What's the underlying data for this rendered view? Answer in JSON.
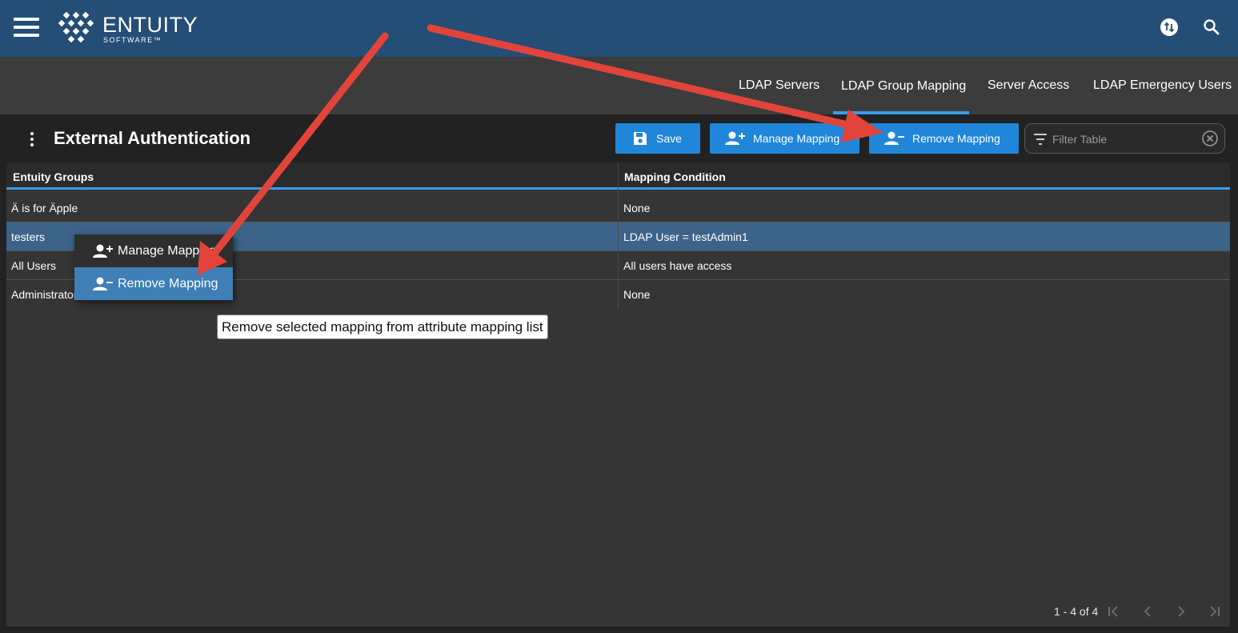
{
  "brand": {
    "name": "ENTUITY",
    "sub": "SOFTWARE™"
  },
  "header_icons": [
    "hamburger-menu-icon",
    "sync-icon",
    "search-icon"
  ],
  "tabs": [
    {
      "label": "LDAP Servers",
      "active": false
    },
    {
      "label": "LDAP Group Mapping",
      "active": true
    },
    {
      "label": "Server Access",
      "active": false
    },
    {
      "label": "LDAP Emergency Users",
      "active": false
    }
  ],
  "page": {
    "title": "External Authentication"
  },
  "toolbar": {
    "save_label": "Save",
    "manage_label": "Manage Mapping",
    "remove_label": "Remove Mapping",
    "filter_placeholder": "Filter Table",
    "filter_value": ""
  },
  "table": {
    "columns": [
      "Entuity Groups",
      "Mapping Condition"
    ],
    "rows": [
      {
        "group": "Ä is for Äpple",
        "condition": "None",
        "selected": false
      },
      {
        "group": "testers",
        "condition": "LDAP User = testAdmin1",
        "selected": true
      },
      {
        "group": "All Users",
        "condition": "All users have access",
        "selected": false
      },
      {
        "group": "Administrators",
        "condition": "None",
        "selected": false
      }
    ]
  },
  "context_menu": {
    "items": [
      {
        "label": "Manage Mapping",
        "icon": "person-add-icon",
        "highlighted": false
      },
      {
        "label": "Remove Mapping",
        "icon": "person-remove-icon",
        "highlighted": true
      }
    ]
  },
  "tooltip": {
    "text": "Remove selected mapping from attribute mapping list"
  },
  "pager": {
    "text": "1 - 4 of 4"
  },
  "colors": {
    "header_bg": "#244e75",
    "tabbar_bg": "#3c3c3c",
    "accent": "#3a9be8",
    "button_bg": "#1f86d9",
    "selected_row": "#3b6488",
    "annotation_arrow": "#e2443c"
  }
}
